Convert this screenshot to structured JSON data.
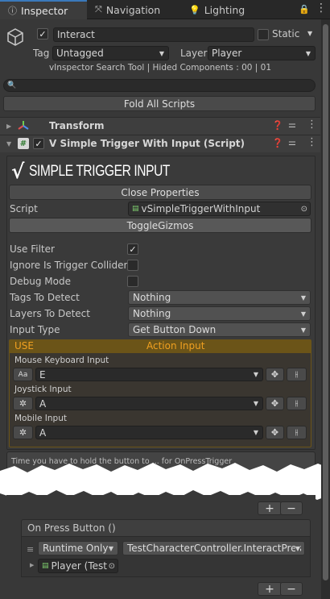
{
  "tabs": [
    {
      "label": "Inspector",
      "icon": "info-icon"
    },
    {
      "label": "Navigation",
      "icon": "navigation-icon"
    },
    {
      "label": "Lighting",
      "icon": "lightbulb-icon"
    }
  ],
  "object": {
    "name": "Interact",
    "static_label": "Static",
    "tag_label": "Tag",
    "tag_value": "Untagged",
    "layer_label": "Layer",
    "layer_value": "Player",
    "search_tool_text": "vInspector Search Tool | Hided Components : 00 | 01",
    "fold_all_label": "Fold All Scripts"
  },
  "components": {
    "transform_label": "Transform",
    "trigger_label": "V Simple Trigger With Input (Script)"
  },
  "trigger": {
    "logo_check": "√",
    "logo_title": "SIMPLE TRIGGER INPUT",
    "close_properties_label": "Close Properties",
    "script_label": "Script",
    "script_value": "vSimpleTriggerWithInput",
    "toggle_gizmos_label": "ToggleGizmos",
    "use_filter_label": "Use Filter",
    "use_filter_checked": "✓",
    "ignore_label": "Ignore Is Trigger Colliders",
    "debug_label": "Debug Mode",
    "tags_label": "Tags To Detect",
    "tags_value": "Nothing",
    "layers_label": "Layers To Detect",
    "layers_value": "Nothing",
    "input_type_label": "Input Type",
    "input_type_value": "Get Button Down",
    "use_label": "USE",
    "action_input_label": "Action Input",
    "mouse_label": "Mouse Keyboard Input",
    "mouse_type": "Aa",
    "mouse_value": "E",
    "joystick_label": "Joystick Input",
    "joystick_value": "A",
    "mobile_label": "Mobile Input",
    "mobile_value": "A",
    "tooltip_text": "Time you have to hold the button to ... for OnPressTrigger"
  },
  "events": {
    "plus": "+",
    "minus": "−",
    "on_press_label": "On Press Button ()",
    "runtime_value": "Runtime Only",
    "function_value": "TestCharacterController.InteractPres",
    "target_value": "Player (Test"
  },
  "colors": {
    "accent": "#3a79bb",
    "action_header": "#6b5418",
    "action_text": "#f0a020",
    "logo": "#ffffff"
  }
}
